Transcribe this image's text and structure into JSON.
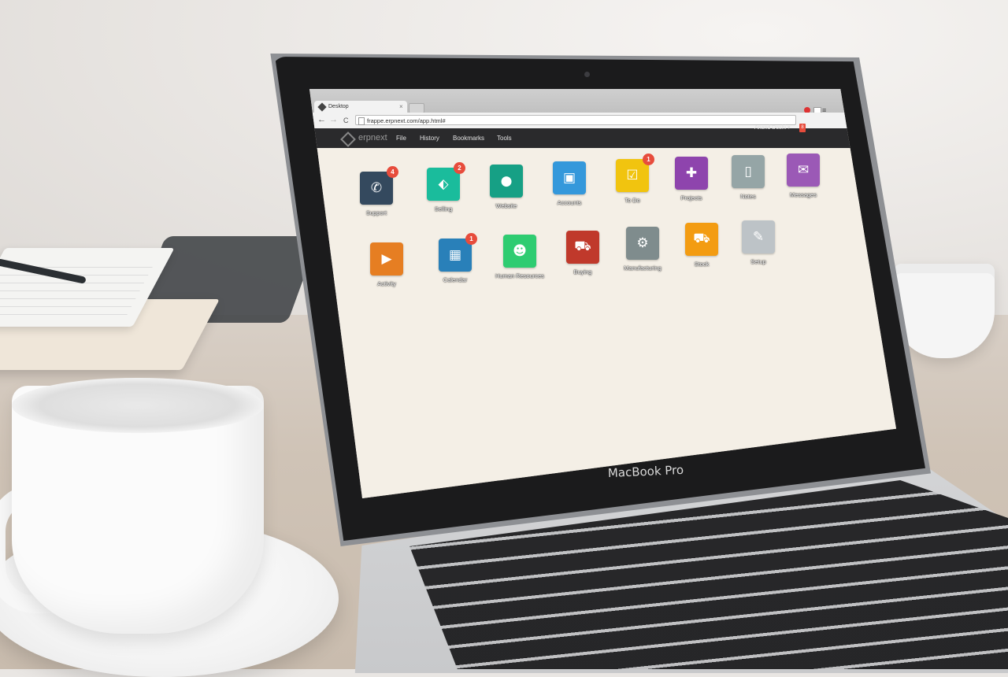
{
  "browser": {
    "tab_title": "Desktop",
    "tab_close": "×",
    "url": "frappe.erpnext.com/app.html#",
    "back": "←",
    "forward": "→",
    "reload": "C",
    "menu": "≡"
  },
  "navbar": {
    "logo": "erpnext",
    "menu": [
      "File",
      "History",
      "Bookmarks",
      "Tools"
    ],
    "user": "Anand Doshi ▾",
    "notification_count": "8"
  },
  "apps": [
    {
      "label": "Support",
      "badge": "4",
      "color": "#34495e",
      "icon": "phone-icon",
      "glyph": "✆"
    },
    {
      "label": "Selling",
      "badge": "2",
      "color": "#1abc9c",
      "icon": "tag-icon",
      "glyph": "⬖"
    },
    {
      "label": "Website",
      "badge": "",
      "color": "#16a085",
      "icon": "globe-icon",
      "glyph": "●"
    },
    {
      "label": "Accounts",
      "badge": "",
      "color": "#3498db",
      "icon": "money-icon",
      "glyph": "▣"
    },
    {
      "label": "To Do",
      "badge": "1",
      "color": "#f1c40f",
      "icon": "check-icon",
      "glyph": "☑"
    },
    {
      "label": "Projects",
      "badge": "",
      "color": "#8e44ad",
      "icon": "puzzle-icon",
      "glyph": "✚"
    },
    {
      "label": "Notes",
      "badge": "",
      "color": "#95a5a6",
      "icon": "file-icon",
      "glyph": "▯"
    },
    {
      "label": "Messages",
      "badge": "",
      "color": "#9b59b6",
      "icon": "comments-icon",
      "glyph": "✉"
    },
    {
      "label": "Activity",
      "badge": "",
      "color": "#e67e22",
      "icon": "play-icon",
      "glyph": "▶"
    },
    {
      "label": "Calendar",
      "badge": "1",
      "color": "#2980b9",
      "icon": "calendar-icon",
      "glyph": "▦"
    },
    {
      "label": "Human Resources",
      "badge": "",
      "color": "#2ecc71",
      "icon": "group-icon",
      "glyph": "☻"
    },
    {
      "label": "Buying",
      "badge": "",
      "color": "#c0392b",
      "icon": "cart-icon",
      "glyph": "⛟"
    },
    {
      "label": "Manufacturing",
      "badge": "",
      "color": "#7f8c8d",
      "icon": "cogs-icon",
      "glyph": "⚙"
    },
    {
      "label": "Stock",
      "badge": "",
      "color": "#f39c12",
      "icon": "truck-icon",
      "glyph": "⛟"
    },
    {
      "label": "Setup",
      "badge": "",
      "color": "#bdc3c7",
      "icon": "wrench-icon",
      "glyph": "✎"
    }
  ],
  "laptop": {
    "brand": "MacBook Pro"
  }
}
